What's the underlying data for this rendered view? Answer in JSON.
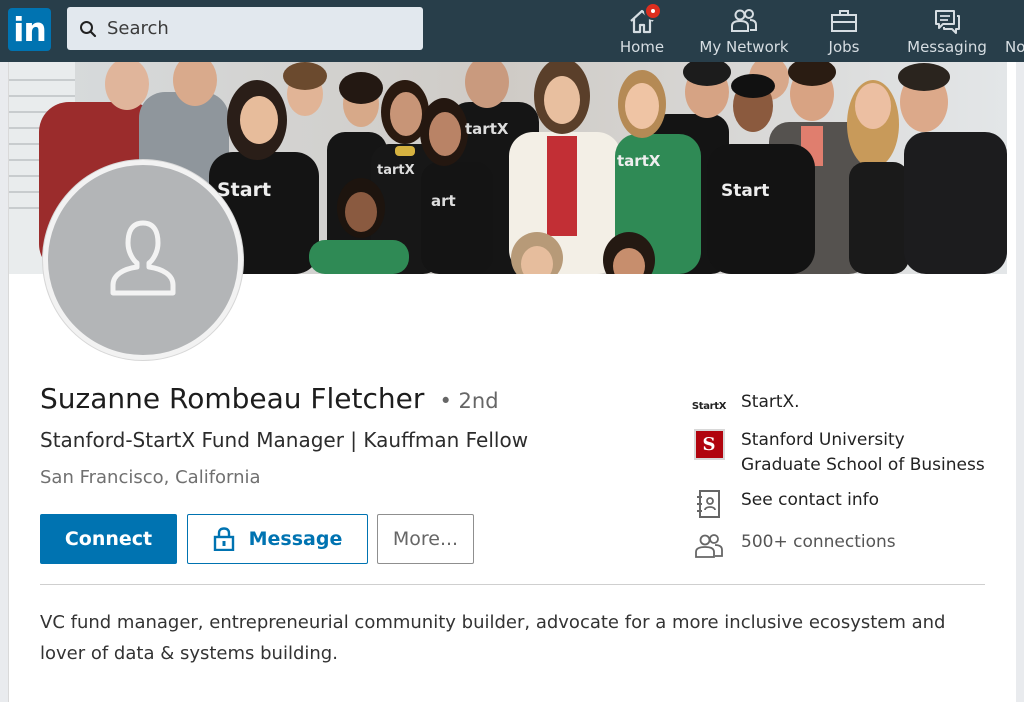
{
  "nav": {
    "logo_text": "in",
    "search_placeholder": "Search",
    "items": [
      {
        "label": "Home",
        "icon": "home-icon",
        "has_badge": true
      },
      {
        "label": "My Network",
        "icon": "network-icon"
      },
      {
        "label": "Jobs",
        "icon": "briefcase-icon"
      },
      {
        "label": "Messaging",
        "icon": "messaging-icon"
      },
      {
        "label": "No",
        "icon": "notifications-icon"
      }
    ],
    "colors": {
      "bar": "#283e4a",
      "brand": "#0073b1",
      "badge": "#dd2e1f"
    }
  },
  "cover": {
    "shirt_texts": [
      "Start",
      "tartX",
      "tartX",
      "art",
      "tartX",
      "Start",
      "tartX"
    ]
  },
  "profile": {
    "name": "Suzanne Rombeau Fletcher",
    "degree": "• 2nd",
    "headline": "Stanford-StartX Fund Manager | Kauffman Fellow",
    "location": "San Francisco, California",
    "avatar_icon": "person-placeholder-icon"
  },
  "actions": {
    "connect_label": "Connect",
    "message_label": "Message",
    "more_label": "More..."
  },
  "sidebar": {
    "company_logo_text": "StartX",
    "company": "StartX.",
    "school_logo_text": "S",
    "school": "Stanford University Graduate School of Business",
    "contact_info": "See contact info",
    "connections": "500+ connections"
  },
  "summary": "VC fund manager, entrepreneurial community builder, advocate for a more inclusive ecosystem and lover of data & systems building."
}
